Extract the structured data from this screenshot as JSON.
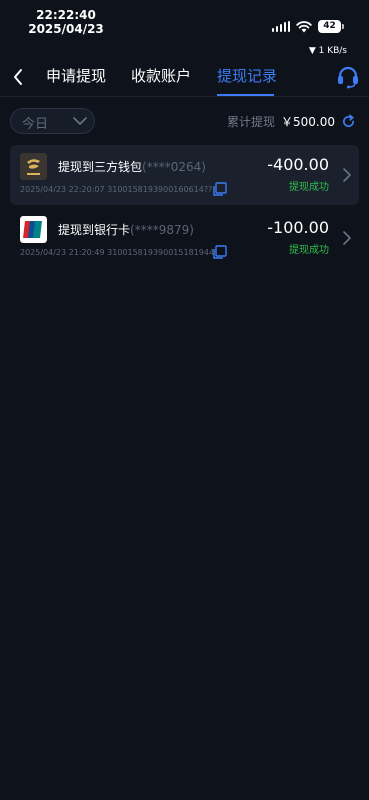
{
  "status_bar": {
    "time": "22:22:40",
    "date": "2025/04/23",
    "battery": "42",
    "net_speed": "▼ 1 KB/s"
  },
  "nav": {
    "tabs": [
      {
        "label": "申请提现",
        "active": false
      },
      {
        "label": "收款账户",
        "active": false
      },
      {
        "label": "提现记录",
        "active": true
      }
    ],
    "accent": "#3d7cf4"
  },
  "filter": {
    "date_selected": "今日",
    "total_label": "累计提现",
    "total_value": "￥500.00"
  },
  "records": [
    {
      "icon": "wallet-logo-icon",
      "title": "提现到三方钱包",
      "account_masked": "(****0264)",
      "datetime": "2025/04/23 22:20:07",
      "order_no": "3100158193900160614??",
      "amount": "-400.00",
      "status": "提现成功"
    },
    {
      "icon": "unionpay-icon",
      "title": "提现到银行卡",
      "account_masked": "(****9879)",
      "datetime": "2025/04/23 21:20:49",
      "order_no": "310015819390015181944",
      "amount": "-100.00",
      "status": "提现成功"
    }
  ],
  "colors": {
    "background": "#0e121b",
    "success": "#2fbd4d"
  }
}
